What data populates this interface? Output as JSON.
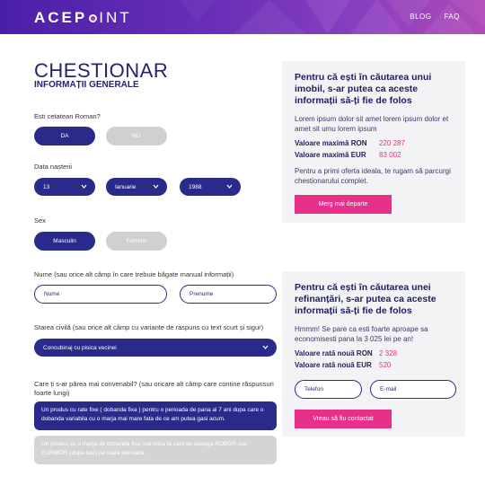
{
  "header": {
    "logo_left": "ACEP",
    "logo_right": "INT",
    "nav": [
      "BLOG",
      "FAQ"
    ]
  },
  "page": {
    "title": "CHESTIONAR",
    "subtitle": "INFORMAȚII GENERALE"
  },
  "form": {
    "citizen": {
      "label": "Esti cetatean Roman?",
      "yes": "DA",
      "no": "NU",
      "selected": "DA"
    },
    "birth": {
      "label": "Data nașterii",
      "day": "13",
      "month": "Ianuarie",
      "year": "1988"
    },
    "sex": {
      "label": "Sex",
      "male": "Masculin",
      "female": "Feminin",
      "selected": "Masculin"
    },
    "name": {
      "label": "Nume (sau orice alt câmp în care trebuie băgate manual informații)",
      "last_placeholder": "Nume",
      "first_placeholder": "Prenume"
    },
    "civil": {
      "label": "Starea civilă (sau orice alt câmp cu variante de raspuns cu text scurt și sigur)",
      "value": "Concubinaj cu pisica vecinei"
    },
    "convenient": {
      "label": "Care ți s-ar părea mai convenabil? (sau oricare alt câmp care contine răspunsuri foarte lungi)",
      "options": [
        "Un produs cu rate fixe ( dobanda fixa ) pentru o perioada de pana al 7 ani dupa care o dobanda variabila cu o marja mai mare fata de ce am putea gasi acum.",
        "Un produs cu o marja de dobanda fixa mai mica la care se adauga ROBOR sau EURIBOR (dupa caz) pe toata perioada."
      ],
      "selected_index": 0
    }
  },
  "card1": {
    "heading": "Pentru că ești în căutarea unui imobil, s-ar putea ca aceste informații să-ți fie de folos",
    "body": "Lorem ipsum dolor sit amet lorem ipsum dolor et amet sit umu lorem ipsum",
    "ron_label": "Valoare maximă RON",
    "ron_value": "220 287",
    "eur_label": "Valoare maximă EUR",
    "eur_value": "83 002",
    "footer": "Pentru a primi oferta ideala, te rugam să parcurgi chestionarului complet.",
    "button": "Merg mai departe"
  },
  "card2": {
    "heading": "Pentru că ești în căutarea unei refinanțări, s-ar putea ca aceste informații să-ți fie de folos",
    "body": "Hmmm! Se pare ca esti foarte aproape sa economisesti pana la 3 025 lei pe an!",
    "ron_label": "Valoare rată nouă RON",
    "ron_value": "2 328",
    "eur_label": "Valoare rată nouă EUR",
    "eur_value": "520",
    "phone_placeholder": "Telefon",
    "email_placeholder": "E-mail",
    "button": "Vreau să fiu contactat"
  },
  "colors": {
    "primary": "#2a2a8a",
    "accent": "#e8308a",
    "disabled": "#d0d0d0"
  }
}
